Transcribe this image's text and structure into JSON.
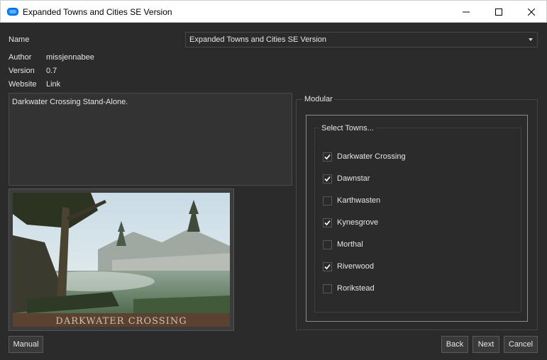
{
  "window": {
    "title": "Expanded Towns and Cities SE Version",
    "icon": "cloud-app-icon",
    "accent_color": "#0a84ff"
  },
  "info": {
    "name_label": "Name",
    "selected_option": "Expanded Towns and Cities SE Version",
    "author_label": "Author",
    "author_value": "missjennabee",
    "version_label": "Version",
    "version_value": "0.7",
    "website_label": "Website",
    "website_value": "Link"
  },
  "description": "Darkwater Crossing Stand-Alone.",
  "preview": {
    "caption": "DARKWATER CROSSING"
  },
  "modular": {
    "group_title": "Modular",
    "select_title": "Select Towns...",
    "options": [
      {
        "label": "Darkwater Crossing",
        "checked": true
      },
      {
        "label": "Dawnstar",
        "checked": true
      },
      {
        "label": "Karthwasten",
        "checked": false
      },
      {
        "label": "Kynesgrove",
        "checked": true
      },
      {
        "label": "Morthal",
        "checked": false
      },
      {
        "label": "Riverwood",
        "checked": true
      },
      {
        "label": "Rorikstead",
        "checked": false
      }
    ]
  },
  "buttons": {
    "manual": "Manual",
    "back": "Back",
    "next": "Next",
    "cancel": "Cancel"
  }
}
